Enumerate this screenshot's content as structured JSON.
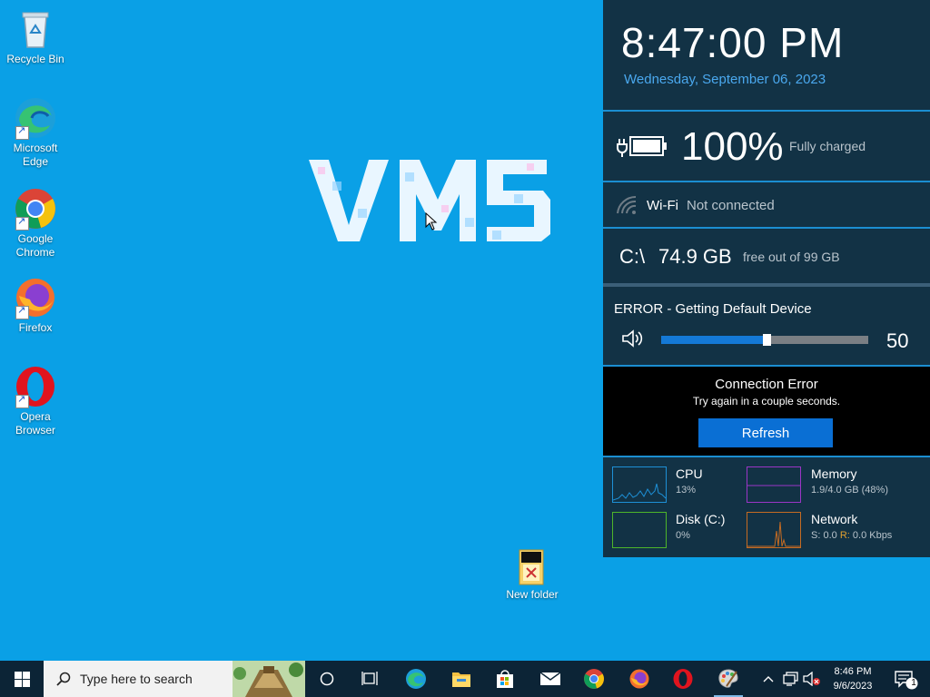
{
  "desktop": {
    "icons": [
      {
        "label": "Recycle Bin"
      },
      {
        "label": "Microsoft Edge"
      },
      {
        "label": "Google Chrome"
      },
      {
        "label": "Firefox"
      },
      {
        "label": "Opera Browser"
      }
    ],
    "folder": {
      "label": "New folder"
    },
    "logo_text": "VM5"
  },
  "widgets": {
    "clock": {
      "time": "8:47:00 PM",
      "date": "Wednesday, September 06, 2023"
    },
    "battery": {
      "percent": "100%",
      "status": "Fully charged",
      "level": 1.0
    },
    "wifi": {
      "label": "Wi-Fi",
      "status": "Not connected"
    },
    "disk": {
      "drive": "C:\\",
      "free": "74.9 GB",
      "total": "free out of 99 GB"
    },
    "audio": {
      "error": "ERROR - Getting Default Device",
      "volume": "50",
      "volume_fraction": 0.5
    },
    "connection": {
      "title": "Connection Error",
      "message": "Try again in a couple seconds.",
      "button": "Refresh"
    },
    "performance": {
      "cpu": {
        "name": "CPU",
        "value": "13%",
        "color": "#1e90d6"
      },
      "memory": {
        "name": "Memory",
        "value": "1.9/4.0 GB (48%)",
        "color": "#9b35c6"
      },
      "disk": {
        "name": "Disk (C:)",
        "value": "0%",
        "color": "#4eb52a"
      },
      "network": {
        "name": "Network",
        "send_label": "S:",
        "send_value": "0.0",
        "recv_label": "R:",
        "recv_value": "0.0 Kbps",
        "color": "#c56b22"
      }
    }
  },
  "taskbar": {
    "search_placeholder": "Type here to search",
    "clock_time": "8:46 PM",
    "clock_date": "9/6/2023",
    "notification_count": "1"
  }
}
